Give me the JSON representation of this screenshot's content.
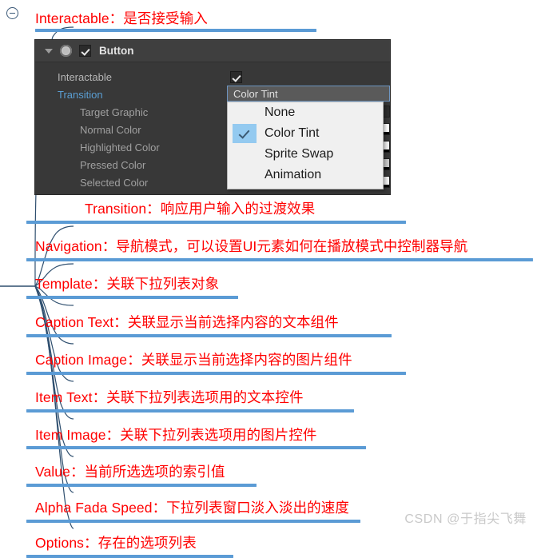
{
  "root_node": {
    "icon": "collapse-circle-minus-icon",
    "title": "Interactable：是否接受输入"
  },
  "inspector": {
    "header": {
      "foldout_icon": "triangle-down-icon",
      "component_icon": "button-component-icon",
      "enabled_checkbox": "checkbox-checked-icon",
      "title": "Button"
    },
    "rows": [
      {
        "label": "Interactable",
        "style": "plain",
        "field": "checkbox"
      },
      {
        "label": "Transition",
        "style": "accent",
        "field": "popup"
      },
      {
        "label": "Target Graphic",
        "style": "indent2",
        "field": "object"
      },
      {
        "label": "Normal Color",
        "style": "indent2",
        "field": "color"
      },
      {
        "label": "Highlighted Color",
        "style": "indent2",
        "field": "color"
      },
      {
        "label": "Pressed Color",
        "style": "indent2",
        "field": "color"
      },
      {
        "label": "Selected Color",
        "style": "indent2",
        "field": "color"
      }
    ],
    "transition_value": "Color Tint"
  },
  "dropdown_menu": {
    "items": [
      {
        "label": "None",
        "checked": false
      },
      {
        "label": "Color Tint",
        "checked": true
      },
      {
        "label": "Sprite Swap",
        "checked": false
      },
      {
        "label": "Animation",
        "checked": false
      }
    ]
  },
  "notes": [
    {
      "text": "Transition：响应用户输入的过渡效果"
    },
    {
      "text": "Navigation：导航模式，可以设置UI元素如何在播放模式中控制器导航"
    },
    {
      "text": "Template：关联下拉列表对象"
    },
    {
      "text": "Caption Text：关联显示当前选择内容的文本组件"
    },
    {
      "text": "Caption Image：关联显示当前选择内容的图片组件"
    },
    {
      "text": "Item Text：关联下拉列表选项用的文本控件"
    },
    {
      "text": "Item Image：关联下拉列表选项用的图片控件"
    },
    {
      "text": "Value：当前所选选项的索引值"
    },
    {
      "text": "Alpha Fada Speed：下拉列表窗口淡入淡出的速度"
    },
    {
      "text": "Options：存在的选项列表"
    }
  ],
  "watermark": "CSDN @于指尖飞舞",
  "colors": {
    "note_text": "#ff0000",
    "underline": "#5b9bd5",
    "connector": "#2f4f6f",
    "inspector_bg": "#383838",
    "inspector_accent": "#5a9fd4",
    "menu_highlight": "#94caf0"
  }
}
